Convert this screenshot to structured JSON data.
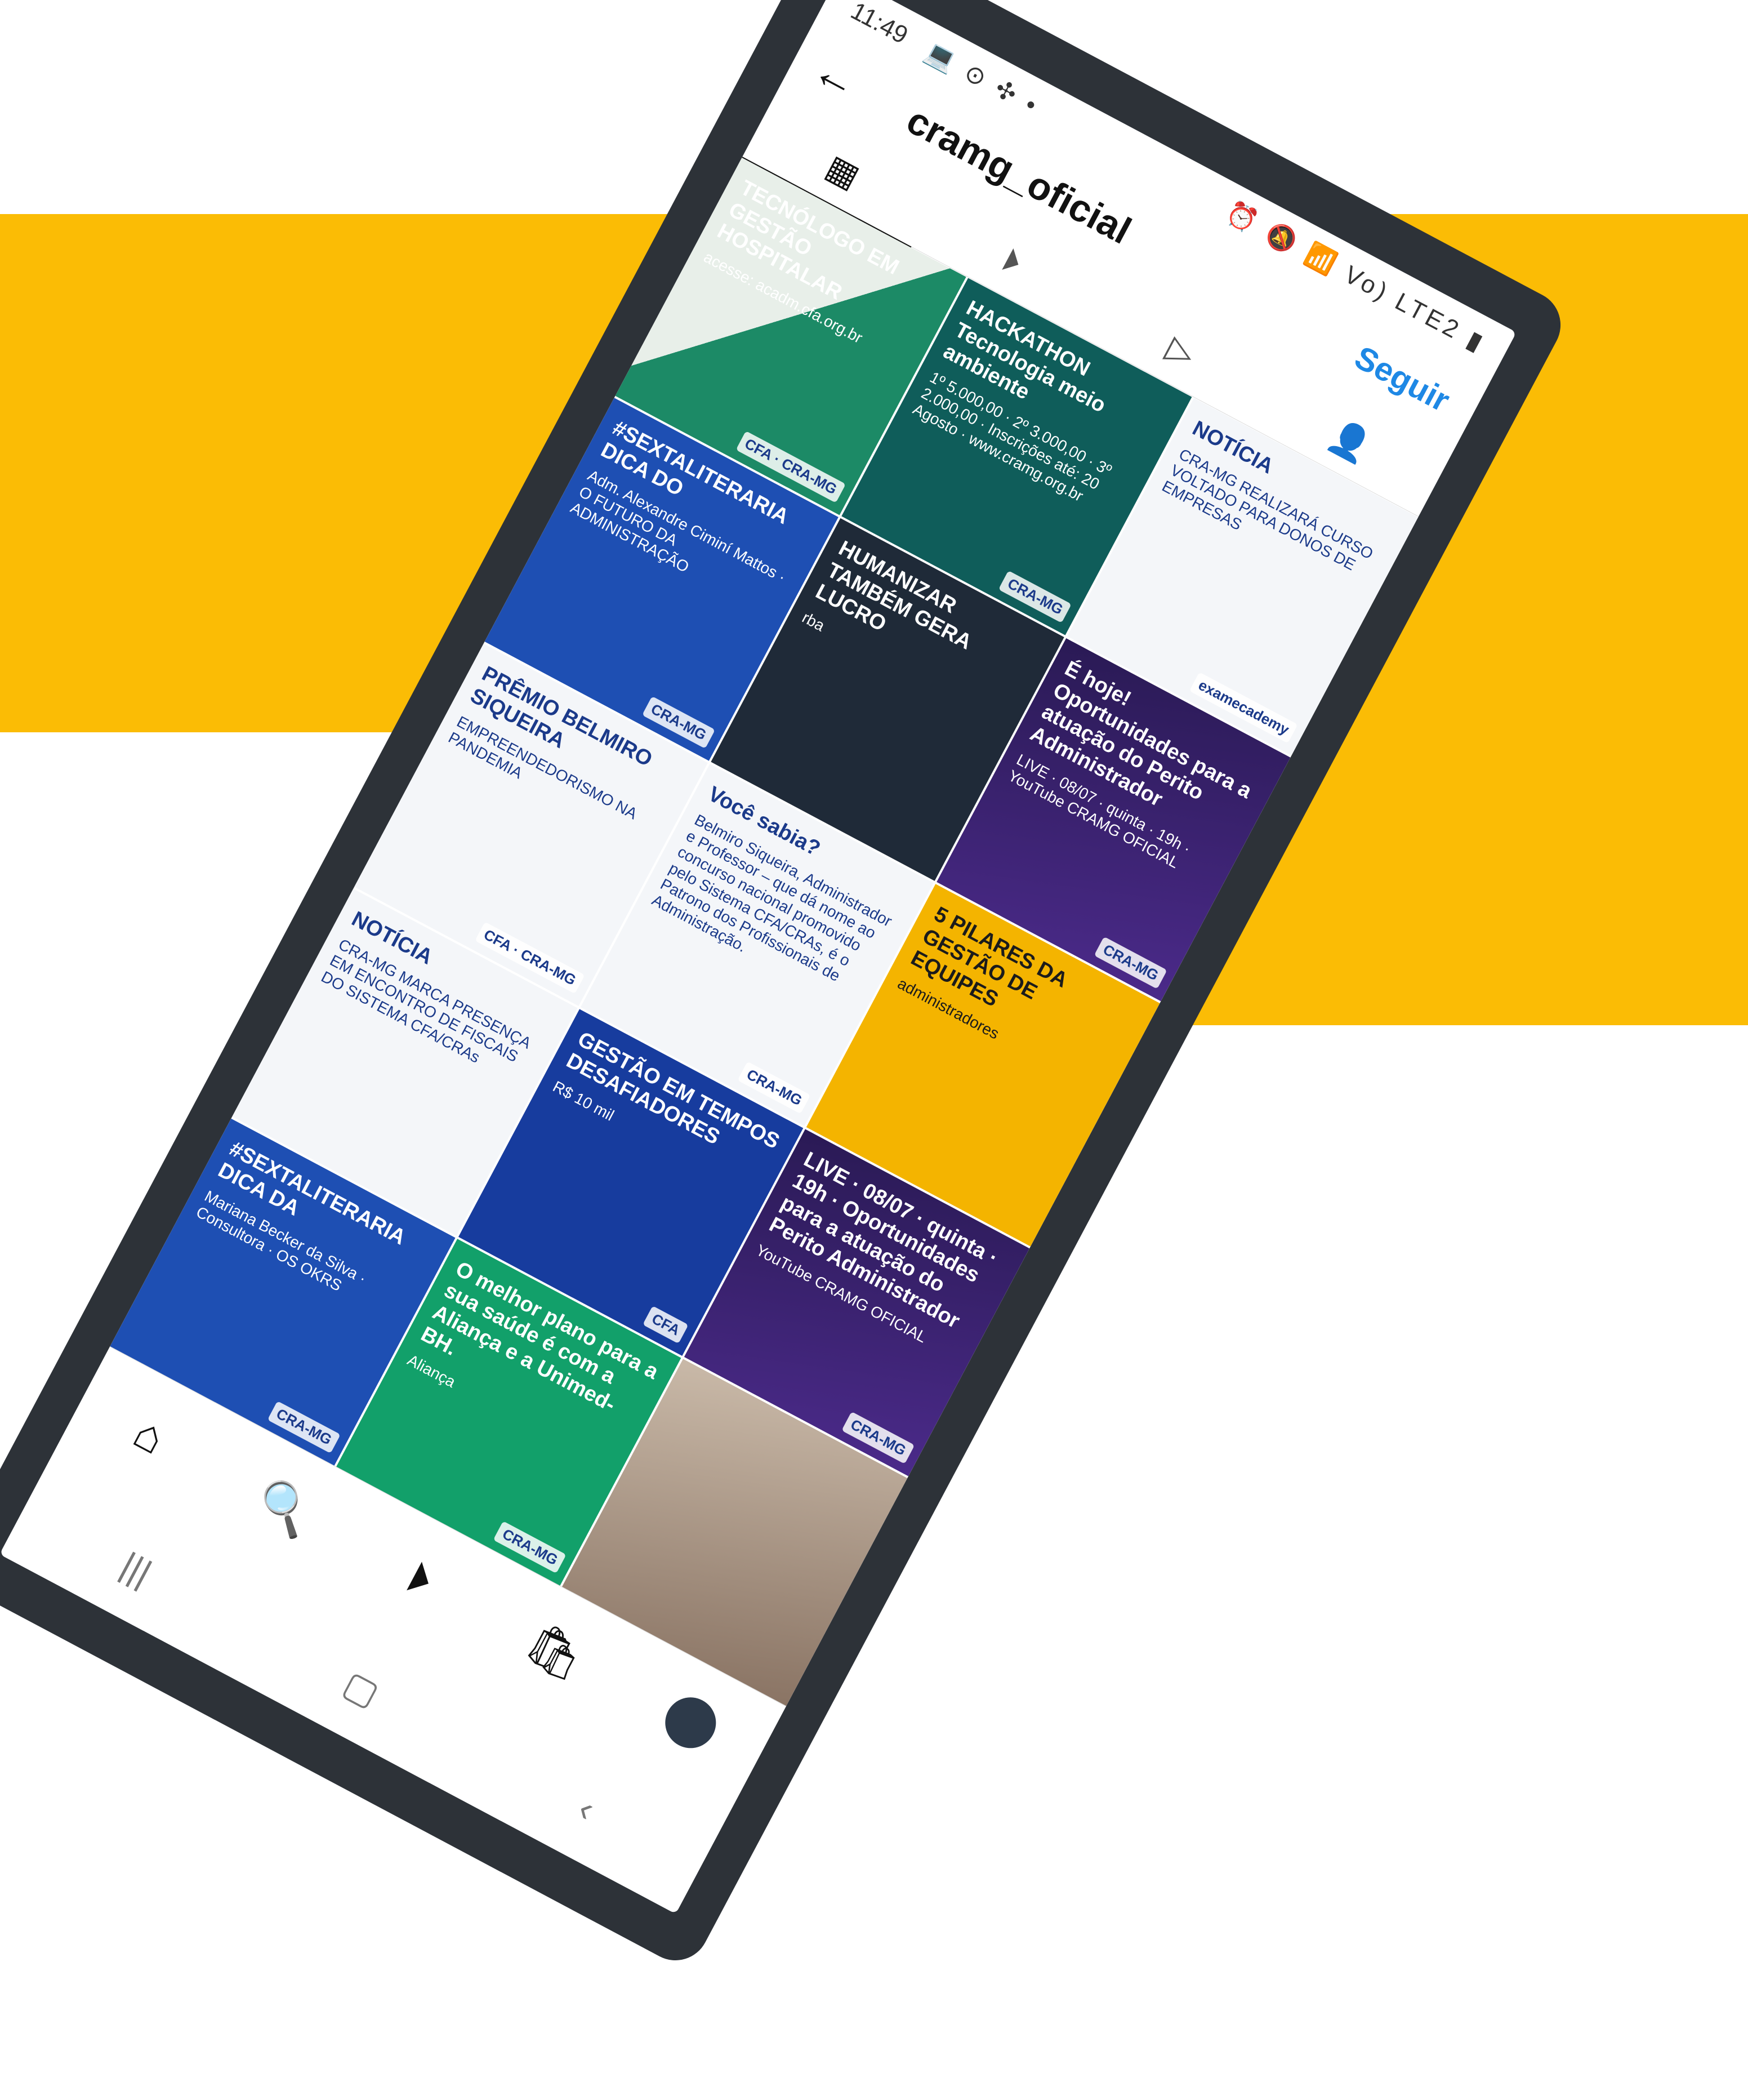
{
  "colors": {
    "band": "#fbbc05",
    "phone_frame": "#2d3238",
    "follow": "#1e88e5"
  },
  "status_bar": {
    "time": "11:49",
    "left_icons": "💻 ⊙ ✣ •",
    "right_icons": "⏰ 🔕 📶 Vo) LTE2 ▮"
  },
  "header": {
    "back_icon": "←",
    "username": "cramg_oficial",
    "follow_label": "Seguir"
  },
  "tabs": [
    {
      "name": "grid-icon",
      "glyph": "▦"
    },
    {
      "name": "reels-icon",
      "glyph": "⏵"
    },
    {
      "name": "play-icon",
      "glyph": "▷"
    },
    {
      "name": "tagged-icon",
      "glyph": "👤"
    }
  ],
  "posts": [
    {
      "title": "TECNÓLOGO EM GESTÃO HOSPITALAR",
      "sub": "acesse: acadm.cfa.org.br",
      "badge": "CFA · CRA-MG"
    },
    {
      "title": "HACKATHON Tecnologia meio ambiente",
      "sub": "1º 5.000,00 · 2º 3.000,00 · 3º 2.000,00 · Inscrições até: 20 Agosto · www.cramg.org.br",
      "badge": "CRA-MG"
    },
    {
      "title": "NOTÍCIA",
      "sub": "CRA-MG REALIZARÁ CURSO VOLTADO PARA DONOS DE EMPRESAS",
      "badge": "examecademy"
    },
    {
      "title": "#SEXTALITERARIA DICA DO",
      "sub": "Adm. Alexandre Ciminí Mattos · O FUTURO DA ADMINISTRAÇÃO",
      "badge": "CRA-MG"
    },
    {
      "title": "HUMANIZAR TAMBÉM GERA LUCRO",
      "sub": "rba",
      "badge": ""
    },
    {
      "title": "É hoje! Oportunidades para a atuação do Perito Administrador",
      "sub": "LIVE · 08/07 · quinta · 19h · YouTube CRAMG OFICIAL",
      "badge": "CRA-MG"
    },
    {
      "title": "PRÊMIO BELMIRO SIQUEIRA",
      "sub": "EMPREENDEDORISMO NA PANDEMIA",
      "badge": "CFA · CRA-MG"
    },
    {
      "title": "Você sabia?",
      "sub": "Belmiro Siqueira, Administrador e Professor – que dá nome ao concurso nacional promovido pelo Sistema CFA/CRAs, é o Patrono dos Profissionais de Administração.",
      "badge": "CRA-MG"
    },
    {
      "title": "5 PILARES DA GESTÃO DE EQUIPES",
      "sub": "administradores",
      "badge": ""
    },
    {
      "title": "NOTÍCIA",
      "sub": "CRA-MG MARCA PRESENÇA EM ENCONTRO DE FISCAIS DO SISTEMA CFA/CRAs",
      "badge": ""
    },
    {
      "title": "GESTÃO EM TEMPOS DESAFIADORES",
      "sub": "R$ 10 mil",
      "badge": "CFA"
    },
    {
      "title": "LIVE · 08/07 · quinta · 19h · Oportunidades para a atuação do Perito Administrador",
      "sub": "YouTube CRAMG OFICIAL",
      "badge": "CRA-MG"
    },
    {
      "title": "#SEXTALITERARIA DICA DA",
      "sub": "Mariana Becker da Silva · Consultora · OS OKRS",
      "badge": "CRA-MG"
    },
    {
      "title": "O melhor plano para a sua saúde é com a Aliança e a Unimed-BH.",
      "sub": "Aliança",
      "badge": "CRA-MG"
    },
    {
      "title": "",
      "sub": "",
      "badge": ""
    }
  ],
  "bottom_nav": [
    {
      "name": "home-icon",
      "glyph": "⌂"
    },
    {
      "name": "search-icon",
      "glyph": "🔍"
    },
    {
      "name": "reels-nav-icon",
      "glyph": "⏵"
    },
    {
      "name": "shop-icon",
      "glyph": "🛍"
    },
    {
      "name": "profile-avatar",
      "glyph": ""
    }
  ],
  "system_nav": [
    {
      "name": "recent-apps-icon",
      "glyph": "|||"
    },
    {
      "name": "home-system-icon",
      "glyph": "▢"
    },
    {
      "name": "back-system-icon",
      "glyph": "‹"
    }
  ]
}
